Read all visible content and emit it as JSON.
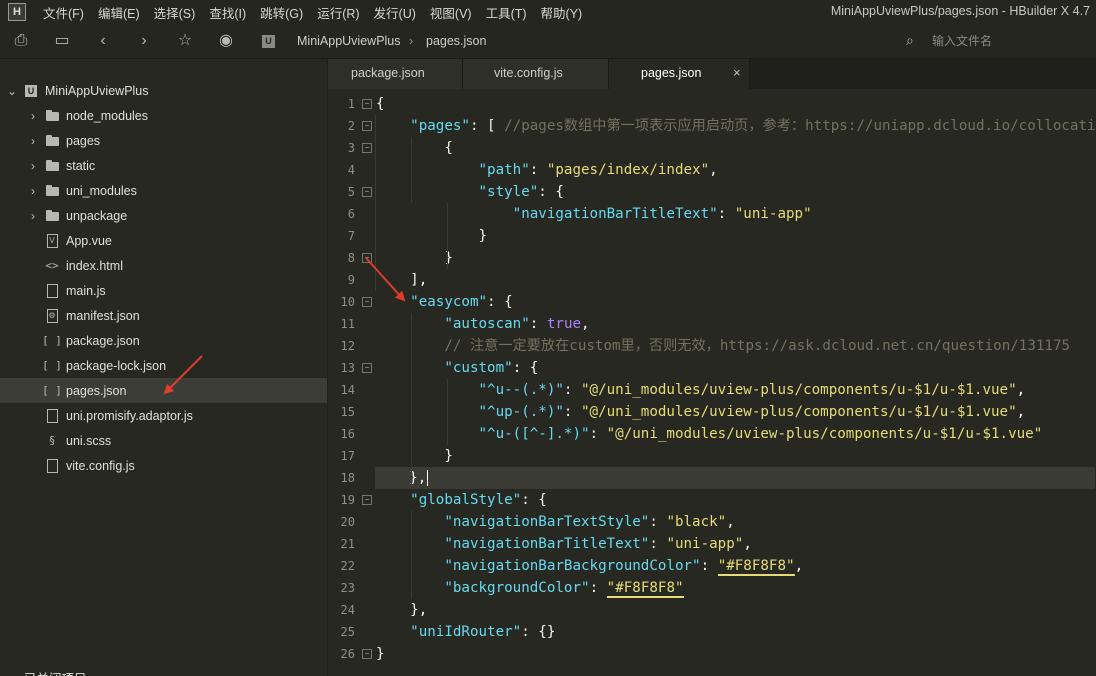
{
  "app": {
    "logo": "H",
    "window_title": "MiniAppUviewPlus/pages.json - HBuilder X 4.7"
  },
  "menu": [
    "文件(F)",
    "编辑(E)",
    "选择(S)",
    "查找(I)",
    "跳转(G)",
    "运行(R)",
    "发行(U)",
    "视图(V)",
    "工具(T)",
    "帮助(Y)"
  ],
  "toolbar": {
    "icons": [
      "new-file-icon",
      "save-icon",
      "back-icon",
      "forward-icon",
      "star-icon",
      "run-icon"
    ],
    "breadcrumb_badge": "U",
    "breadcrumb": [
      "MiniAppUviewPlus",
      "pages.json"
    ],
    "search_placeholder": "输入文件名"
  },
  "sidebar": {
    "project": "MiniAppUviewPlus",
    "items": [
      {
        "label": "node_modules",
        "type": "folder"
      },
      {
        "label": "pages",
        "type": "folder"
      },
      {
        "label": "static",
        "type": "folder"
      },
      {
        "label": "uni_modules",
        "type": "folder"
      },
      {
        "label": "unpackage",
        "type": "folder"
      },
      {
        "label": "App.vue",
        "type": "vue"
      },
      {
        "label": "index.html",
        "type": "html"
      },
      {
        "label": "main.js",
        "type": "js"
      },
      {
        "label": "manifest.json",
        "type": "manifest"
      },
      {
        "label": "package.json",
        "type": "json"
      },
      {
        "label": "package-lock.json",
        "type": "json"
      },
      {
        "label": "pages.json",
        "type": "json",
        "selected": true
      },
      {
        "label": "uni.promisify.adaptor.js",
        "type": "js"
      },
      {
        "label": "uni.scss",
        "type": "scss"
      },
      {
        "label": "vite.config.js",
        "type": "js"
      }
    ],
    "bottom_label": "已关闭项目"
  },
  "tabs": [
    {
      "label": "package.json",
      "active": false
    },
    {
      "label": "vite.config.js",
      "active": false
    },
    {
      "label": "pages.json",
      "active": true,
      "close": "×"
    }
  ],
  "editor": {
    "line_numbers": [
      "1",
      "2",
      "3",
      "4",
      "5",
      "6",
      "7",
      "8",
      "9",
      "10",
      "11",
      "12",
      "13",
      "14",
      "15",
      "16",
      "17",
      "18",
      "19",
      "20",
      "21",
      "22",
      "23",
      "24",
      "25",
      "26"
    ],
    "current_line": 18,
    "colors": {
      "keyword": "#66d9ef",
      "string": "#e6db74",
      "comment": "#75715e",
      "boolean": "#ae81ff",
      "background": "#272822",
      "annotation_arrow": "#e03b2f"
    },
    "lines": [
      [
        {
          "t": "{",
          "c": "p"
        }
      ],
      [
        {
          "t": "    ",
          "c": "p"
        },
        {
          "t": "\"pages\"",
          "c": "k"
        },
        {
          "t": ": [ ",
          "c": "p"
        },
        {
          "t": "//pages数组中第一项表示应用启动页，参考：https://uniapp.dcloud.io/collocation/pages",
          "c": "c"
        }
      ],
      [
        {
          "t": "        {",
          "c": "p"
        }
      ],
      [
        {
          "t": "            ",
          "c": "p"
        },
        {
          "t": "\"path\"",
          "c": "k"
        },
        {
          "t": ": ",
          "c": "p"
        },
        {
          "t": "\"pages/index/index\"",
          "c": "s"
        },
        {
          "t": ",",
          "c": "p"
        }
      ],
      [
        {
          "t": "            ",
          "c": "p"
        },
        {
          "t": "\"style\"",
          "c": "k"
        },
        {
          "t": ": {",
          "c": "p"
        }
      ],
      [
        {
          "t": "                ",
          "c": "p"
        },
        {
          "t": "\"navigationBarTitleText\"",
          "c": "k"
        },
        {
          "t": ": ",
          "c": "p"
        },
        {
          "t": "\"uni-app\"",
          "c": "s"
        }
      ],
      [
        {
          "t": "            }",
          "c": "p"
        }
      ],
      [
        {
          "t": "        }",
          "c": "p"
        }
      ],
      [
        {
          "t": "    ],",
          "c": "p"
        }
      ],
      [
        {
          "t": "    ",
          "c": "p"
        },
        {
          "t": "\"easycom\"",
          "c": "k"
        },
        {
          "t": ": {",
          "c": "p"
        }
      ],
      [
        {
          "t": "        ",
          "c": "p"
        },
        {
          "t": "\"autoscan\"",
          "c": "k"
        },
        {
          "t": ": ",
          "c": "p"
        },
        {
          "t": "true",
          "c": "b"
        },
        {
          "t": ",",
          "c": "p"
        }
      ],
      [
        {
          "t": "        ",
          "c": "p"
        },
        {
          "t": "// 注意一定要放在custom里，否则无效，https://ask.dcloud.net.cn/question/131175",
          "c": "c"
        }
      ],
      [
        {
          "t": "        ",
          "c": "p"
        },
        {
          "t": "\"custom\"",
          "c": "k"
        },
        {
          "t": ": {",
          "c": "p"
        }
      ],
      [
        {
          "t": "            ",
          "c": "p"
        },
        {
          "t": "\"^u--(.*)\"",
          "c": "k"
        },
        {
          "t": ": ",
          "c": "p"
        },
        {
          "t": "\"@/uni_modules/uview-plus/components/u-$1/u-$1.vue\"",
          "c": "s"
        },
        {
          "t": ",",
          "c": "p"
        }
      ],
      [
        {
          "t": "            ",
          "c": "p"
        },
        {
          "t": "\"^up-(.*)\"",
          "c": "k"
        },
        {
          "t": ": ",
          "c": "p"
        },
        {
          "t": "\"@/uni_modules/uview-plus/components/u-$1/u-$1.vue\"",
          "c": "s"
        },
        {
          "t": ",",
          "c": "p"
        }
      ],
      [
        {
          "t": "            ",
          "c": "p"
        },
        {
          "t": "\"^u-([^-].*)\"",
          "c": "k"
        },
        {
          "t": ": ",
          "c": "p"
        },
        {
          "t": "\"@/uni_modules/uview-plus/components/u-$1/u-$1.vue\"",
          "c": "s"
        }
      ],
      [
        {
          "t": "        }",
          "c": "p"
        }
      ],
      [
        {
          "t": "    },",
          "c": "p"
        }
      ],
      [
        {
          "t": "    ",
          "c": "p"
        },
        {
          "t": "\"globalStyle\"",
          "c": "k"
        },
        {
          "t": ": {",
          "c": "p"
        }
      ],
      [
        {
          "t": "        ",
          "c": "p"
        },
        {
          "t": "\"navigationBarTextStyle\"",
          "c": "k"
        },
        {
          "t": ": ",
          "c": "p"
        },
        {
          "t": "\"black\"",
          "c": "s"
        },
        {
          "t": ",",
          "c": "p"
        }
      ],
      [
        {
          "t": "        ",
          "c": "p"
        },
        {
          "t": "\"navigationBarTitleText\"",
          "c": "k"
        },
        {
          "t": ": ",
          "c": "p"
        },
        {
          "t": "\"uni-app\"",
          "c": "s"
        },
        {
          "t": ",",
          "c": "p"
        }
      ],
      [
        {
          "t": "        ",
          "c": "p"
        },
        {
          "t": "\"navigationBarBackgroundColor\"",
          "c": "k"
        },
        {
          "t": ": ",
          "c": "p"
        },
        {
          "t": "\"#F8F8F8\"",
          "c": "s u"
        },
        {
          "t": ",",
          "c": "p"
        }
      ],
      [
        {
          "t": "        ",
          "c": "p"
        },
        {
          "t": "\"backgroundColor\"",
          "c": "k"
        },
        {
          "t": ": ",
          "c": "p"
        },
        {
          "t": "\"#F8F8F8\"",
          "c": "s u"
        }
      ],
      [
        {
          "t": "    },",
          "c": "p"
        }
      ],
      [
        {
          "t": "    ",
          "c": "p"
        },
        {
          "t": "\"uniIdRouter\"",
          "c": "k"
        },
        {
          "t": ": {}",
          "c": "p"
        }
      ],
      [
        {
          "t": "}",
          "c": "p"
        }
      ]
    ],
    "foldable_lines": [
      1,
      2,
      3,
      5,
      8,
      10,
      13,
      19,
      26
    ]
  }
}
